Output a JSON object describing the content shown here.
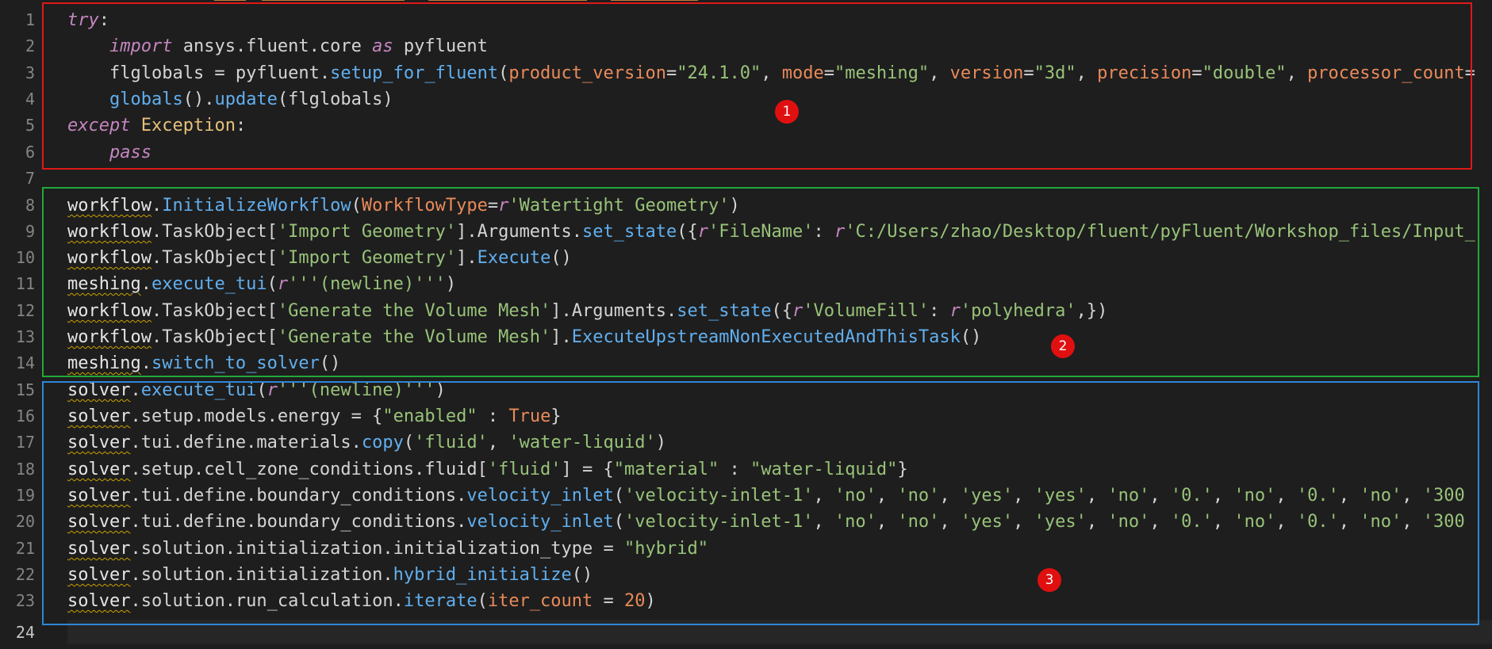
{
  "editor": {
    "colors": {
      "background": "#1e1e1e",
      "box1": "#e01818",
      "box2": "#22a83a",
      "box3": "#2f86d6",
      "badge": "#e01010"
    },
    "badges": [
      "1",
      "2",
      "3"
    ],
    "lines": [
      {
        "n": "1",
        "tokens": [
          {
            "t": "try",
            "c": "kw"
          },
          {
            "t": ":"
          }
        ]
      },
      {
        "n": "2",
        "tokens": [
          {
            "t": "    "
          },
          {
            "t": "import",
            "c": "kw"
          },
          {
            "t": " ansys.fluent.core "
          },
          {
            "t": "as",
            "c": "kw"
          },
          {
            "t": " pyfluent"
          }
        ]
      },
      {
        "n": "3",
        "tokens": [
          {
            "t": "    flglobals = pyfluent."
          },
          {
            "t": "setup_for_fluent",
            "c": "fn"
          },
          {
            "t": "("
          },
          {
            "t": "product_version",
            "c": "par"
          },
          {
            "t": "="
          },
          {
            "t": "\"24.1.0\"",
            "c": "str"
          },
          {
            "t": ", "
          },
          {
            "t": "mode",
            "c": "par"
          },
          {
            "t": "="
          },
          {
            "t": "\"meshing\"",
            "c": "str"
          },
          {
            "t": ", "
          },
          {
            "t": "version",
            "c": "par"
          },
          {
            "t": "="
          },
          {
            "t": "\"3d\"",
            "c": "str"
          },
          {
            "t": ", "
          },
          {
            "t": "precision",
            "c": "par"
          },
          {
            "t": "="
          },
          {
            "t": "\"double\"",
            "c": "str"
          },
          {
            "t": ", "
          },
          {
            "t": "processor_count",
            "c": "par"
          },
          {
            "t": "="
          }
        ]
      },
      {
        "n": "4",
        "tokens": [
          {
            "t": "    "
          },
          {
            "t": "globals",
            "c": "fn"
          },
          {
            "t": "()."
          },
          {
            "t": "update",
            "c": "fn"
          },
          {
            "t": "(flglobals)"
          }
        ]
      },
      {
        "n": "5",
        "tokens": [
          {
            "t": "except",
            "c": "kw"
          },
          {
            "t": " "
          },
          {
            "t": "Exception",
            "c": "cls"
          },
          {
            "t": ":"
          }
        ]
      },
      {
        "n": "6",
        "tokens": [
          {
            "t": "    "
          },
          {
            "t": "pass",
            "c": "kw"
          }
        ]
      },
      {
        "n": "7",
        "tokens": []
      },
      {
        "n": "8",
        "tokens": [
          {
            "t": "workflow",
            "c": "var"
          },
          {
            "t": "."
          },
          {
            "t": "InitializeWorkflow",
            "c": "fn"
          },
          {
            "t": "("
          },
          {
            "t": "WorkflowType",
            "c": "par"
          },
          {
            "t": "="
          },
          {
            "t": "r",
            "c": "kw"
          },
          {
            "t": "'Watertight Geometry'",
            "c": "str"
          },
          {
            "t": ")"
          }
        ]
      },
      {
        "n": "9",
        "tokens": [
          {
            "t": "workflow",
            "c": "var"
          },
          {
            "t": ".TaskObject["
          },
          {
            "t": "'Import Geometry'",
            "c": "str"
          },
          {
            "t": "].Arguments."
          },
          {
            "t": "set_state",
            "c": "fn"
          },
          {
            "t": "({"
          },
          {
            "t": "r",
            "c": "kw"
          },
          {
            "t": "'FileName'",
            "c": "str"
          },
          {
            "t": ": "
          },
          {
            "t": "r",
            "c": "kw"
          },
          {
            "t": "'C:/Users/zhao/Desktop/fluent/pyFluent/Workshop_files/Input_",
            "c": "str"
          }
        ]
      },
      {
        "n": "10",
        "tokens": [
          {
            "t": "workflow",
            "c": "var"
          },
          {
            "t": ".TaskObject["
          },
          {
            "t": "'Import Geometry'",
            "c": "str"
          },
          {
            "t": "]."
          },
          {
            "t": "Execute",
            "c": "fn"
          },
          {
            "t": "()"
          }
        ]
      },
      {
        "n": "11",
        "tokens": [
          {
            "t": "meshing",
            "c": "var"
          },
          {
            "t": "."
          },
          {
            "t": "execute_tui",
            "c": "fn"
          },
          {
            "t": "("
          },
          {
            "t": "r",
            "c": "kw"
          },
          {
            "t": "'''(newline)'''",
            "c": "str"
          },
          {
            "t": ")"
          }
        ]
      },
      {
        "n": "12",
        "tokens": [
          {
            "t": "workflow",
            "c": "var"
          },
          {
            "t": ".TaskObject["
          },
          {
            "t": "'Generate the Volume Mesh'",
            "c": "str"
          },
          {
            "t": "].Arguments."
          },
          {
            "t": "set_state",
            "c": "fn"
          },
          {
            "t": "({"
          },
          {
            "t": "r",
            "c": "kw"
          },
          {
            "t": "'VolumeFill'",
            "c": "str"
          },
          {
            "t": ": "
          },
          {
            "t": "r",
            "c": "kw"
          },
          {
            "t": "'polyhedra'",
            "c": "str"
          },
          {
            "t": ",})"
          }
        ]
      },
      {
        "n": "13",
        "tokens": [
          {
            "t": "workflow",
            "c": "var"
          },
          {
            "t": ".TaskObject["
          },
          {
            "t": "'Generate the Volume Mesh'",
            "c": "str"
          },
          {
            "t": "]."
          },
          {
            "t": "ExecuteUpstreamNonExecutedAndThisTask",
            "c": "fn"
          },
          {
            "t": "()"
          }
        ]
      },
      {
        "n": "14",
        "tokens": [
          {
            "t": "meshing",
            "c": "var"
          },
          {
            "t": "."
          },
          {
            "t": "switch_to_solver",
            "c": "fn"
          },
          {
            "t": "()"
          }
        ]
      },
      {
        "n": "15",
        "tokens": [
          {
            "t": "solver",
            "c": "var"
          },
          {
            "t": "."
          },
          {
            "t": "execute_tui",
            "c": "fn"
          },
          {
            "t": "("
          },
          {
            "t": "r",
            "c": "kw"
          },
          {
            "t": "'''(newline)'''",
            "c": "str"
          },
          {
            "t": ")"
          }
        ]
      },
      {
        "n": "16",
        "tokens": [
          {
            "t": "solver",
            "c": "var"
          },
          {
            "t": ".setup.models.energy = {"
          },
          {
            "t": "\"enabled\"",
            "c": "str"
          },
          {
            "t": " : "
          },
          {
            "t": "True",
            "c": "num"
          },
          {
            "t": "}"
          }
        ]
      },
      {
        "n": "17",
        "tokens": [
          {
            "t": "solver",
            "c": "var"
          },
          {
            "t": ".tui.define.materials."
          },
          {
            "t": "copy",
            "c": "fn"
          },
          {
            "t": "("
          },
          {
            "t": "'fluid'",
            "c": "str"
          },
          {
            "t": ", "
          },
          {
            "t": "'water-liquid'",
            "c": "str"
          },
          {
            "t": ")"
          }
        ]
      },
      {
        "n": "18",
        "tokens": [
          {
            "t": "solver",
            "c": "var"
          },
          {
            "t": ".setup.cell_zone_conditions.fluid["
          },
          {
            "t": "'fluid'",
            "c": "str"
          },
          {
            "t": "] = {"
          },
          {
            "t": "\"material\"",
            "c": "str"
          },
          {
            "t": " : "
          },
          {
            "t": "\"water-liquid\"",
            "c": "str"
          },
          {
            "t": "}"
          }
        ]
      },
      {
        "n": "19",
        "tokens": [
          {
            "t": "solver",
            "c": "var"
          },
          {
            "t": ".tui.define.boundary_conditions."
          },
          {
            "t": "velocity_inlet",
            "c": "fn"
          },
          {
            "t": "("
          },
          {
            "t": "'velocity-inlet-1'",
            "c": "str"
          },
          {
            "t": ", "
          },
          {
            "t": "'no'",
            "c": "str"
          },
          {
            "t": ", "
          },
          {
            "t": "'no'",
            "c": "str"
          },
          {
            "t": ", "
          },
          {
            "t": "'yes'",
            "c": "str"
          },
          {
            "t": ", "
          },
          {
            "t": "'yes'",
            "c": "str"
          },
          {
            "t": ", "
          },
          {
            "t": "'no'",
            "c": "str"
          },
          {
            "t": ", "
          },
          {
            "t": "'0.'",
            "c": "str"
          },
          {
            "t": ", "
          },
          {
            "t": "'no'",
            "c": "str"
          },
          {
            "t": ", "
          },
          {
            "t": "'0.'",
            "c": "str"
          },
          {
            "t": ", "
          },
          {
            "t": "'no'",
            "c": "str"
          },
          {
            "t": ", "
          },
          {
            "t": "'300",
            "c": "str"
          }
        ]
      },
      {
        "n": "20",
        "tokens": [
          {
            "t": "solver",
            "c": "var"
          },
          {
            "t": ".tui.define.boundary_conditions."
          },
          {
            "t": "velocity_inlet",
            "c": "fn"
          },
          {
            "t": "("
          },
          {
            "t": "'velocity-inlet-1'",
            "c": "str"
          },
          {
            "t": ", "
          },
          {
            "t": "'no'",
            "c": "str"
          },
          {
            "t": ", "
          },
          {
            "t": "'no'",
            "c": "str"
          },
          {
            "t": ", "
          },
          {
            "t": "'yes'",
            "c": "str"
          },
          {
            "t": ", "
          },
          {
            "t": "'yes'",
            "c": "str"
          },
          {
            "t": ", "
          },
          {
            "t": "'no'",
            "c": "str"
          },
          {
            "t": ", "
          },
          {
            "t": "'0.'",
            "c": "str"
          },
          {
            "t": ", "
          },
          {
            "t": "'no'",
            "c": "str"
          },
          {
            "t": ", "
          },
          {
            "t": "'0.'",
            "c": "str"
          },
          {
            "t": ", "
          },
          {
            "t": "'no'",
            "c": "str"
          },
          {
            "t": ", "
          },
          {
            "t": "'300",
            "c": "str"
          }
        ]
      },
      {
        "n": "21",
        "tokens": [
          {
            "t": "solver",
            "c": "var"
          },
          {
            "t": ".solution.initialization.initialization_type = "
          },
          {
            "t": "\"hybrid\"",
            "c": "str"
          }
        ]
      },
      {
        "n": "22",
        "tokens": [
          {
            "t": "solver",
            "c": "var"
          },
          {
            "t": ".solution.initialization."
          },
          {
            "t": "hybrid_initialize",
            "c": "fn"
          },
          {
            "t": "()"
          }
        ]
      },
      {
        "n": "23",
        "tokens": [
          {
            "t": "solver",
            "c": "var"
          },
          {
            "t": ".solution.run_calculation."
          },
          {
            "t": "iterate",
            "c": "fn"
          },
          {
            "t": "("
          },
          {
            "t": "iter_count",
            "c": "par"
          },
          {
            "t": " = "
          },
          {
            "t": "20",
            "c": "num"
          },
          {
            "t": ")"
          }
        ]
      },
      {
        "n": "24",
        "tokens": []
      }
    ]
  }
}
